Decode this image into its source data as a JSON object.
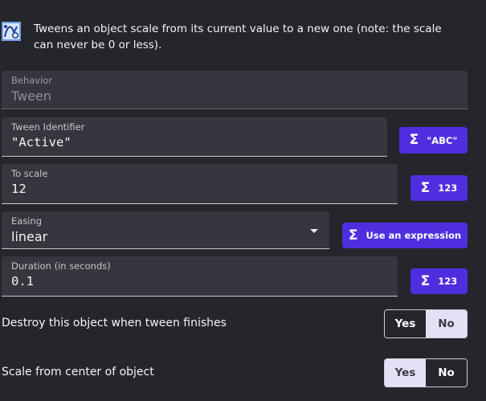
{
  "header": {
    "icon": "tween-scale-icon",
    "description": "Tweens an object scale from its current value to a new one (note: the scale can never be 0 or less)."
  },
  "fields": {
    "behavior": {
      "label": "Behavior",
      "value": "Tween"
    },
    "tween_identifier": {
      "label": "Tween Identifier",
      "value": "\"Active\""
    },
    "to_scale": {
      "label": "To scale",
      "value": "12"
    },
    "easing": {
      "label": "Easing",
      "value": "linear"
    },
    "duration": {
      "label": "Duration (in seconds)",
      "value": "0.1"
    }
  },
  "expression_buttons": {
    "identifier": {
      "icon": "sigma-icon",
      "label": "\"ABC\""
    },
    "to_scale": {
      "icon": "sigma-icon",
      "label": "123"
    },
    "easing": {
      "icon": "sigma-icon",
      "label": "Use an expression"
    },
    "duration": {
      "icon": "sigma-icon",
      "label": "123"
    }
  },
  "toggles": {
    "destroy": {
      "label": "Destroy this object when tween finishes",
      "yes": "Yes",
      "no": "No",
      "selected": "Yes"
    },
    "scale_center": {
      "label": "Scale from center of object",
      "yes": "Yes",
      "no": "No",
      "selected": "No"
    }
  },
  "colors": {
    "background": "#25252c",
    "field": "#36363e",
    "accent": "#4f2ee0"
  }
}
